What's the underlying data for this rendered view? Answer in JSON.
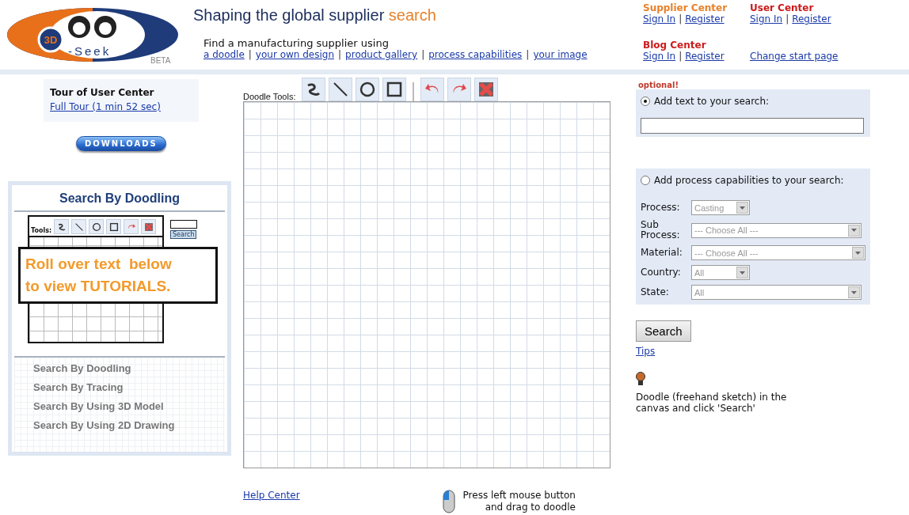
{
  "header": {
    "logo": {
      "badge": "3D",
      "word": "-Seek",
      "tag": "BETA"
    },
    "tagline": [
      {
        "text": "Shaping the global supplier",
        "accent": false
      },
      {
        "text": "search",
        "accent": true
      }
    ],
    "intro": "Find a manufacturing supplier using",
    "separator": "|",
    "links": [
      "a doodle",
      "your own design",
      "product gallery",
      "process capabilities",
      "your image"
    ]
  },
  "account": {
    "centers": [
      {
        "title": "Supplier Center",
        "color": "#e8812a",
        "links": [
          "Sign In",
          "Register"
        ]
      },
      {
        "title": "User Center",
        "color": "#cc1a1a",
        "links": [
          "Sign In",
          "Register"
        ]
      },
      {
        "title": "Blog Center",
        "color": "#cc1a1a",
        "links": [
          "Sign In",
          "Register"
        ]
      }
    ],
    "change_start": "Change start page",
    "separator": "|"
  },
  "tour": {
    "title": "Tour of User Center",
    "link": "Full Tour (1 min 52 sec)"
  },
  "downloads": "DOWNLOADS",
  "tutorials": {
    "title": "Search By Doodling",
    "preview": {
      "tools_label": "Tools:",
      "search_label": "Search",
      "banner": [
        "Roll over text  below",
        "to view TUTORIALS."
      ]
    },
    "items": [
      "Search By Doodling",
      "Search By Tracing",
      "Search By Using 3D Model",
      "Search By Using 2D Drawing"
    ]
  },
  "doodle": {
    "tools_label": "Doodle Tools:",
    "draw_tools": [
      {
        "kind": "freehand"
      },
      {
        "kind": "line"
      },
      {
        "kind": "circle"
      },
      {
        "kind": "square"
      }
    ],
    "edit_tools": [
      {
        "kind": "undo"
      },
      {
        "kind": "redo"
      },
      {
        "kind": "clear"
      }
    ],
    "help_link": "Help Center",
    "mouse_hint": [
      "Press left mouse button",
      "and drag to doodle"
    ]
  },
  "search": {
    "optional": "optional!",
    "text_option": {
      "label": "Add text to your search:",
      "selected": true
    },
    "process_option": {
      "label": "Add process capabilities to your search:",
      "selected": false,
      "fields": [
        {
          "label": "Process:",
          "value": "Casting"
        },
        {
          "label": "Sub Process:",
          "value": "--- Choose All ---"
        },
        {
          "label": "Material:",
          "value": "--- Choose All ---"
        },
        {
          "label": "Country:",
          "value": "All"
        },
        {
          "label": "State:",
          "value": "All"
        }
      ]
    },
    "button": "Search",
    "tips": "Tips",
    "hint": "Doodle (freehand sketch) in the canvas and click 'Search'"
  }
}
